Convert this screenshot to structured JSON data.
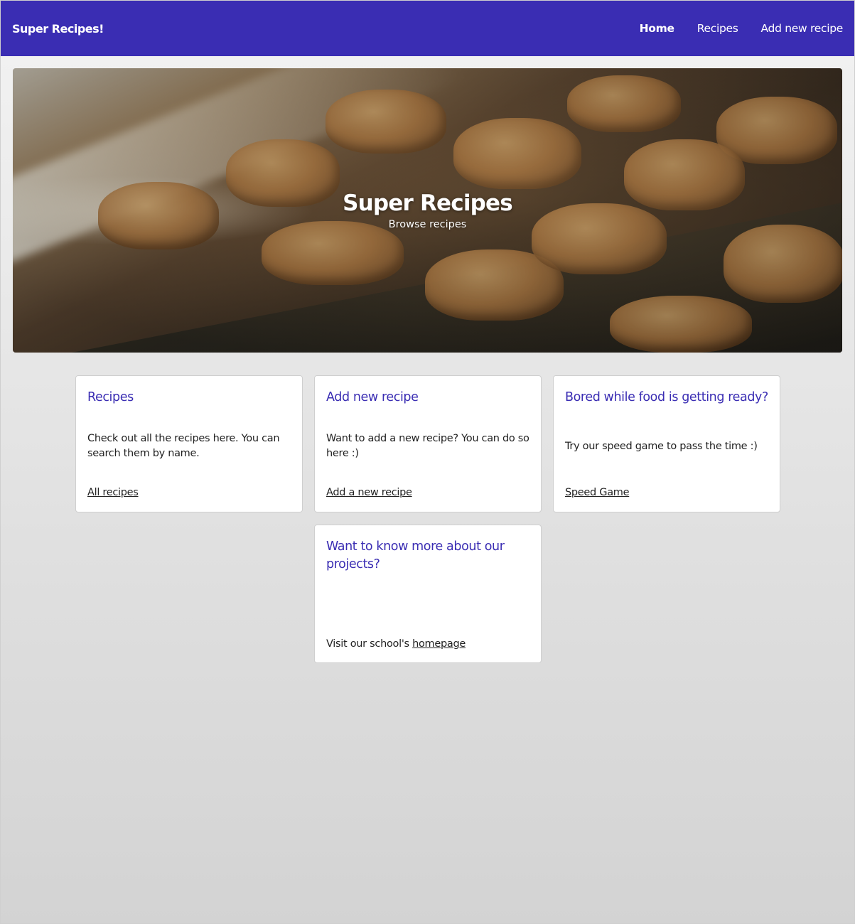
{
  "navbar": {
    "brand": "Super Recipes!",
    "links": [
      {
        "label": "Home",
        "active": true
      },
      {
        "label": "Recipes",
        "active": false
      },
      {
        "label": "Add new recipe",
        "active": false
      }
    ]
  },
  "hero": {
    "title": "Super Recipes",
    "subtitle": "Browse recipes"
  },
  "cards": [
    {
      "title": "Recipes",
      "body": "Check out all the recipes here. You can search them by name.",
      "link": "All recipes"
    },
    {
      "title": "Add new recipe",
      "body": "Want to add a new recipe? You can do so here :)",
      "link": "Add a new recipe"
    },
    {
      "title": "Bored while food is getting ready?",
      "body": "Try our speed game to pass the time :)",
      "link": "Speed Game"
    },
    {
      "title": "Want to know more about our projects?",
      "body_prefix": "Visit our school's",
      "link": "homepage"
    }
  ],
  "colors": {
    "navbar": "#3a2db3",
    "card_title": "#3a2db3"
  }
}
